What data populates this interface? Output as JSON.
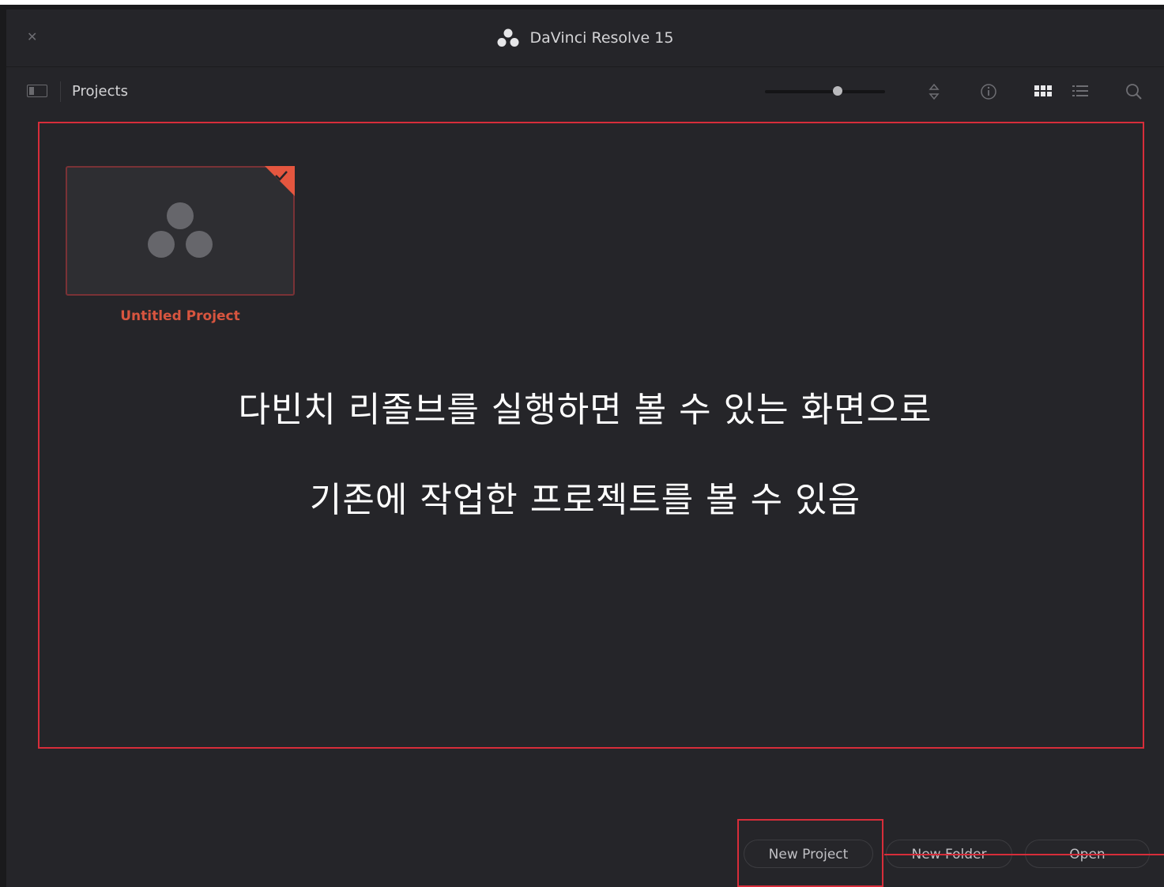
{
  "window": {
    "title": "DaVinci Resolve 15"
  },
  "toolbar": {
    "title": "Projects"
  },
  "project": {
    "name": "Untitled Project"
  },
  "annotation": {
    "line1": "다빈치 리졸브를 실행하면 볼 수 있는 화면으로",
    "line2": "기존에 작업한 프로젝트를 볼 수 있음"
  },
  "buttons": {
    "new_project": "New Project",
    "new_folder": "New Folder",
    "open": "Open"
  },
  "colors": {
    "accent_red": "#d72d3a",
    "project_orange": "#d8553f",
    "background": "#252529"
  },
  "icons": [
    "close-icon",
    "davinci-logo-icon",
    "sidebar-panel-icon",
    "sort-icon",
    "info-icon",
    "grid-view-icon",
    "list-view-icon",
    "search-icon",
    "checkmark-icon"
  ]
}
